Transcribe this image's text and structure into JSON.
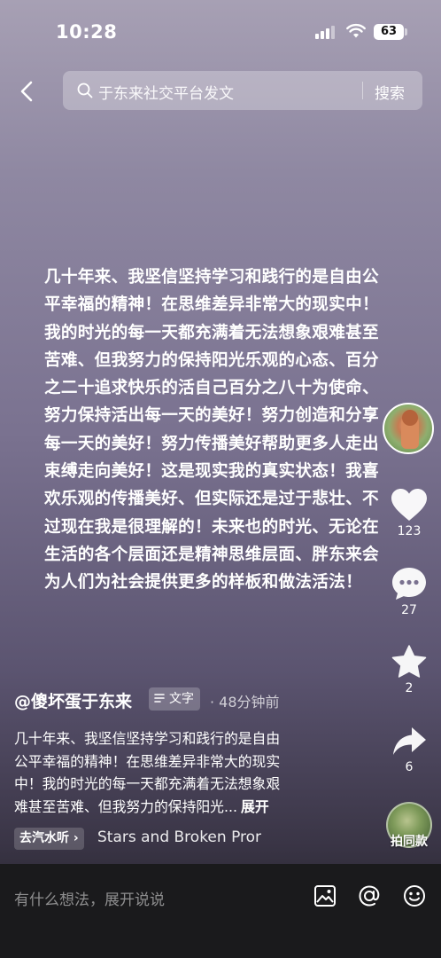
{
  "status_bar": {
    "time": "10:28",
    "battery": "63"
  },
  "top_bar": {
    "search_text": "于东来社交平台发文",
    "search_button": "搜索"
  },
  "post": {
    "lines": [
      "几十年来、我坚信坚持学习和践行的是自由公",
      "平幸福的精神！在思维差异非常大的现实中！",
      "我的时光的每一天都充满着无法想象艰难甚至",
      "苦难、但我努力的保持阳光乐观的心态、百分",
      "之二十追求快乐的活自己百分之八十为使命、",
      "努力保持活出每一天的美好！努力创造和分享",
      "每一天的美好！努力传播美好帮助更多人走出",
      "束缚走向美好！这是现实我的真实状态！我喜",
      "欢乐观的传播美好、但实际还是过于悲壮、不",
      "过现在我是很理解的！未来也的时光、无论在",
      "生活的各个层面还是精神思维层面、胖东来会",
      "为人们为社会提供更多的样板和做法活法！"
    ]
  },
  "actions": {
    "likes": "123",
    "comments": "27",
    "favorites": "2",
    "shares": "6"
  },
  "author": {
    "name": "@傻坏蛋于东来",
    "tag": "文字",
    "time_ago": "· 48分钟前"
  },
  "caption": {
    "lines": [
      "几十年来、我坚信坚持学习和践行的是自由",
      "公平幸福的精神！在思维差异非常大的现实",
      "中！我的时光的每一天都充满着无法想象艰",
      "难甚至苦难、但我努力的保持阳光..."
    ],
    "expand": "展开"
  },
  "music": {
    "chip": "去汽水听 ›",
    "title": "Stars and Broken Pror"
  },
  "same_style": {
    "label": "拍同款"
  },
  "bottom_bar": {
    "placeholder": "有什么想法，展开说说"
  },
  "icons": [
    "back-icon",
    "search-icon",
    "heart-icon",
    "comment-icon",
    "star-icon",
    "share-icon",
    "image-icon",
    "at-icon",
    "emoji-icon"
  ],
  "colors": {
    "bottom_bar": "#1a1a1c",
    "text": "#ffffff"
  }
}
